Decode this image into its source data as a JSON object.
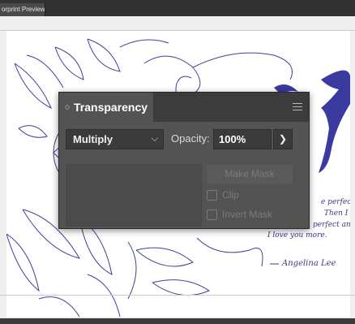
{
  "document": {
    "tab_label": "orprint Preview)"
  },
  "panel": {
    "title": "Transparency",
    "blend_mode": "Multiply",
    "opacity_label": "Opacity:",
    "opacity_value": "100%",
    "make_mask_label": "Make Mask",
    "clip_label": "Clip",
    "invert_mask_label": "Invert Mask"
  },
  "artwork": {
    "script_lines": [
      "e perfect,",
      "Then I",
      "perfect and",
      "I love you more."
    ],
    "signature": "Angelina Lee",
    "ink_color": "#3f3f9a"
  }
}
